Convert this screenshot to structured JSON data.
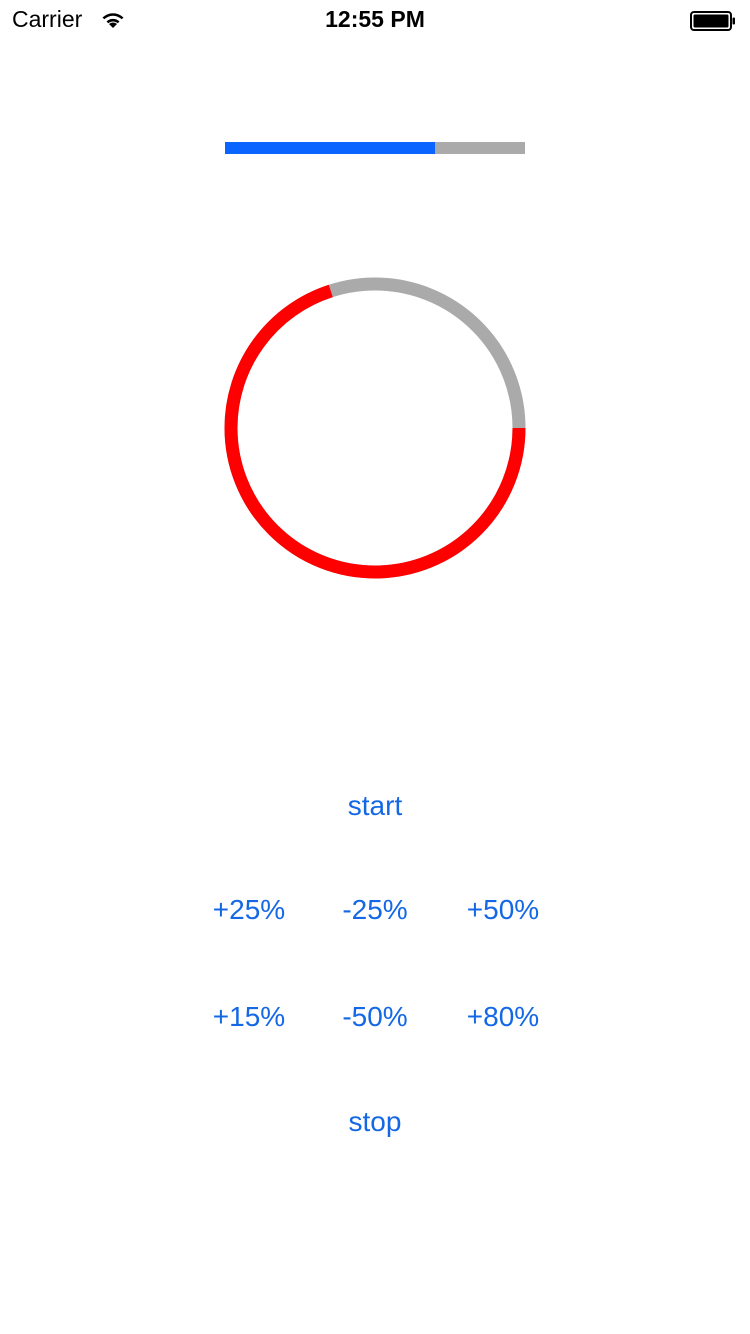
{
  "status_bar": {
    "carrier": "Carrier",
    "time": "12:55 PM",
    "wifi_icon": "wifi-icon",
    "battery_icon": "battery-icon"
  },
  "linear_progress": {
    "value": 0.7,
    "fill_color": "#0a64ff",
    "track_color": "#aaaaaa"
  },
  "circular_progress": {
    "value": 0.7,
    "fill_color": "#ff0000",
    "track_color": "#aaaaaa"
  },
  "buttons": {
    "start": "start",
    "plus25": "+25%",
    "minus25": "-25%",
    "plus50": "+50%",
    "plus15": "+15%",
    "minus50": "-50%",
    "plus80": "+80%",
    "stop": "stop"
  },
  "accent_color": "#1468e6"
}
